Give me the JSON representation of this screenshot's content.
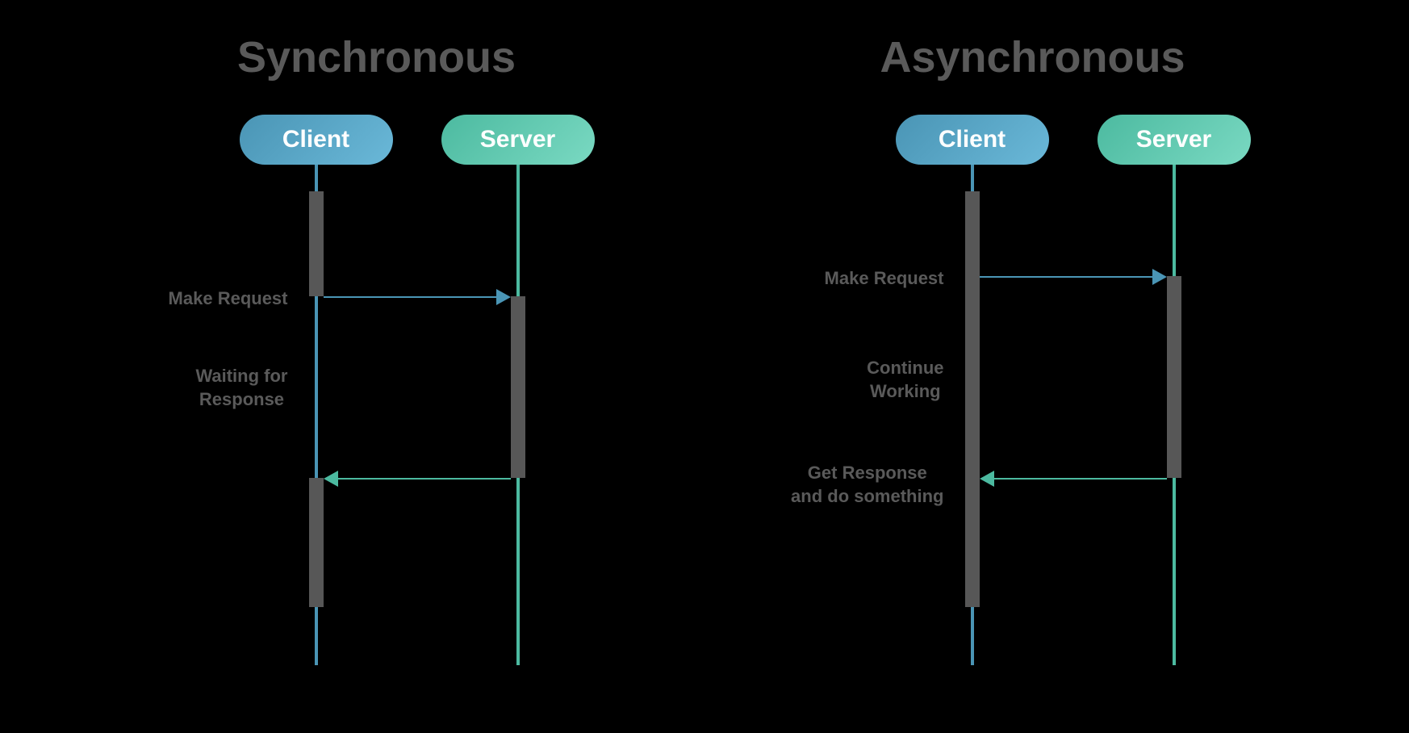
{
  "sync": {
    "title": "Synchronous",
    "client_label": "Client",
    "server_label": "Server",
    "labels": {
      "make_request": "Make Request",
      "waiting_line1": "Waiting for",
      "waiting_line2": "Response"
    }
  },
  "async": {
    "title": "Asynchronous",
    "client_label": "Client",
    "server_label": "Server",
    "labels": {
      "make_request": "Make Request",
      "continue_line1": "Continue",
      "continue_line2": "Working",
      "response_line1": "Get Response",
      "response_line2": "and do something"
    }
  },
  "colors": {
    "client": "#4a95b5",
    "server": "#4cbaa0",
    "text": "#5a5a5a",
    "activation": "#575757",
    "background": "#000000"
  }
}
